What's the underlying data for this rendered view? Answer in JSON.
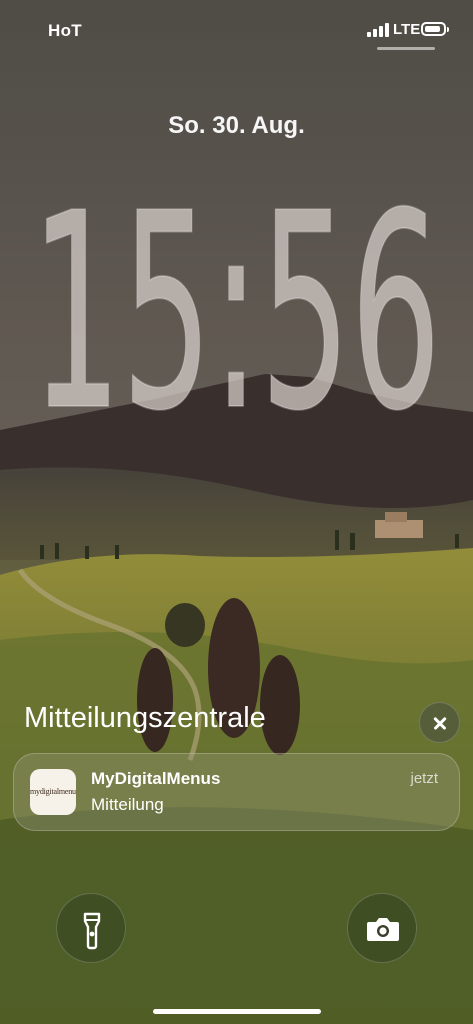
{
  "status_bar": {
    "carrier": "HoT",
    "network": "LTE",
    "signal_icon": "cellular-signal-icon",
    "battery_icon": "battery-icon"
  },
  "lock_screen": {
    "date": "So. 30. Aug.",
    "time": "15:56"
  },
  "notification_center": {
    "title": "Mitteilungszentrale",
    "close_icon": "close-icon"
  },
  "notifications": [
    {
      "app_name": "MyDigitalMenus",
      "message": "Mitteilung",
      "time": "jetzt",
      "icon_text": "mydigitalmenus"
    }
  ],
  "quick_actions": {
    "left_icon": "flashlight-icon",
    "right_icon": "camera-icon"
  },
  "colors": {
    "sky": "#6b645c",
    "hill": "#3a3230",
    "field": "#8c8a3a",
    "clock_fill": "#d8d0cc"
  }
}
